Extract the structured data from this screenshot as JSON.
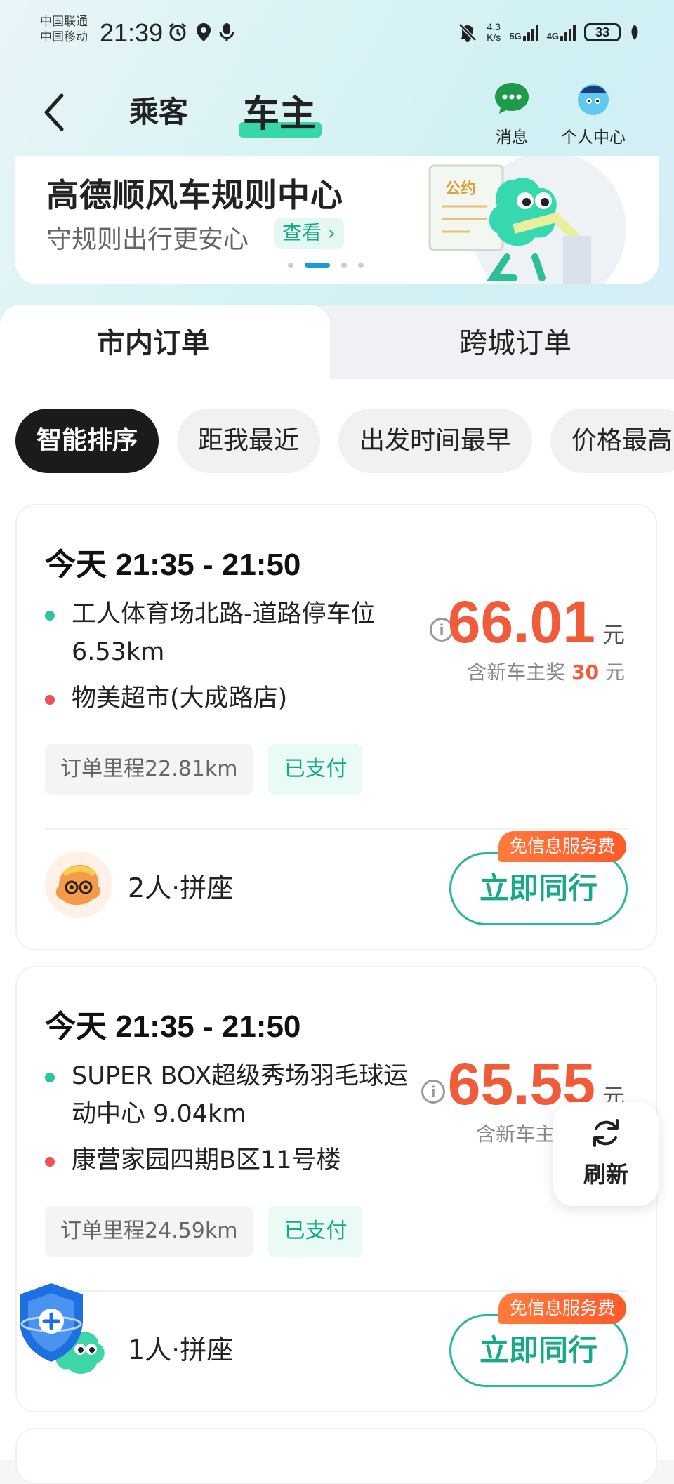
{
  "status_bar": {
    "carrier1": "中国联通",
    "carrier2": "中国移动",
    "time": "21:39",
    "net_speed_value": "4.3",
    "net_speed_unit": "K/s",
    "signal1": "5G",
    "signal2": "4G",
    "battery": "33"
  },
  "header": {
    "tab_passenger": "乘客",
    "tab_owner": "车主",
    "messages_label": "消息",
    "profile_label": "个人中心"
  },
  "banner": {
    "title": "高德顺风车规则中心",
    "subtitle": "守规则出行更安心",
    "view_label": "查看",
    "poster_text": "公约"
  },
  "order_tabs": {
    "city": "市内订单",
    "intercity": "跨城订单"
  },
  "filters": [
    "智能排序",
    "距我最近",
    "出发时间最早",
    "价格最高"
  ],
  "orders": [
    {
      "time": "今天 21:35 - 21:50",
      "from": "工人体育场北路-道路停车位 6.53km",
      "to": "物美超市(大成路店)",
      "price": "66.01",
      "unit": "元",
      "bonus_prefix": "含新车主奖",
      "bonus_value": "30",
      "bonus_unit": "元",
      "mileage": "订单里程22.81km",
      "paid": "已支付",
      "seats": "2人·拼座",
      "fee_tag": "免信息服务费",
      "go_label": "立即同行"
    },
    {
      "time": "今天 21:35 - 21:50",
      "from": "SUPER BOX超级秀场羽毛球运动中心 9.04km",
      "to": "康营家园四期B区11号楼",
      "price": "65.55",
      "unit": "元",
      "bonus_prefix": "含新车主",
      "mileage": "订单里程24.59km",
      "paid": "已支付",
      "seats": "1人·拼座",
      "fee_tag": "免信息服务费",
      "go_label": "立即同行"
    }
  ],
  "floating": {
    "refresh_label": "刷新"
  },
  "colors": {
    "accent_green": "#1aa88a",
    "price_orange": "#f05b3a",
    "from_dot": "#2ec4a0",
    "to_dot": "#f0505a"
  }
}
